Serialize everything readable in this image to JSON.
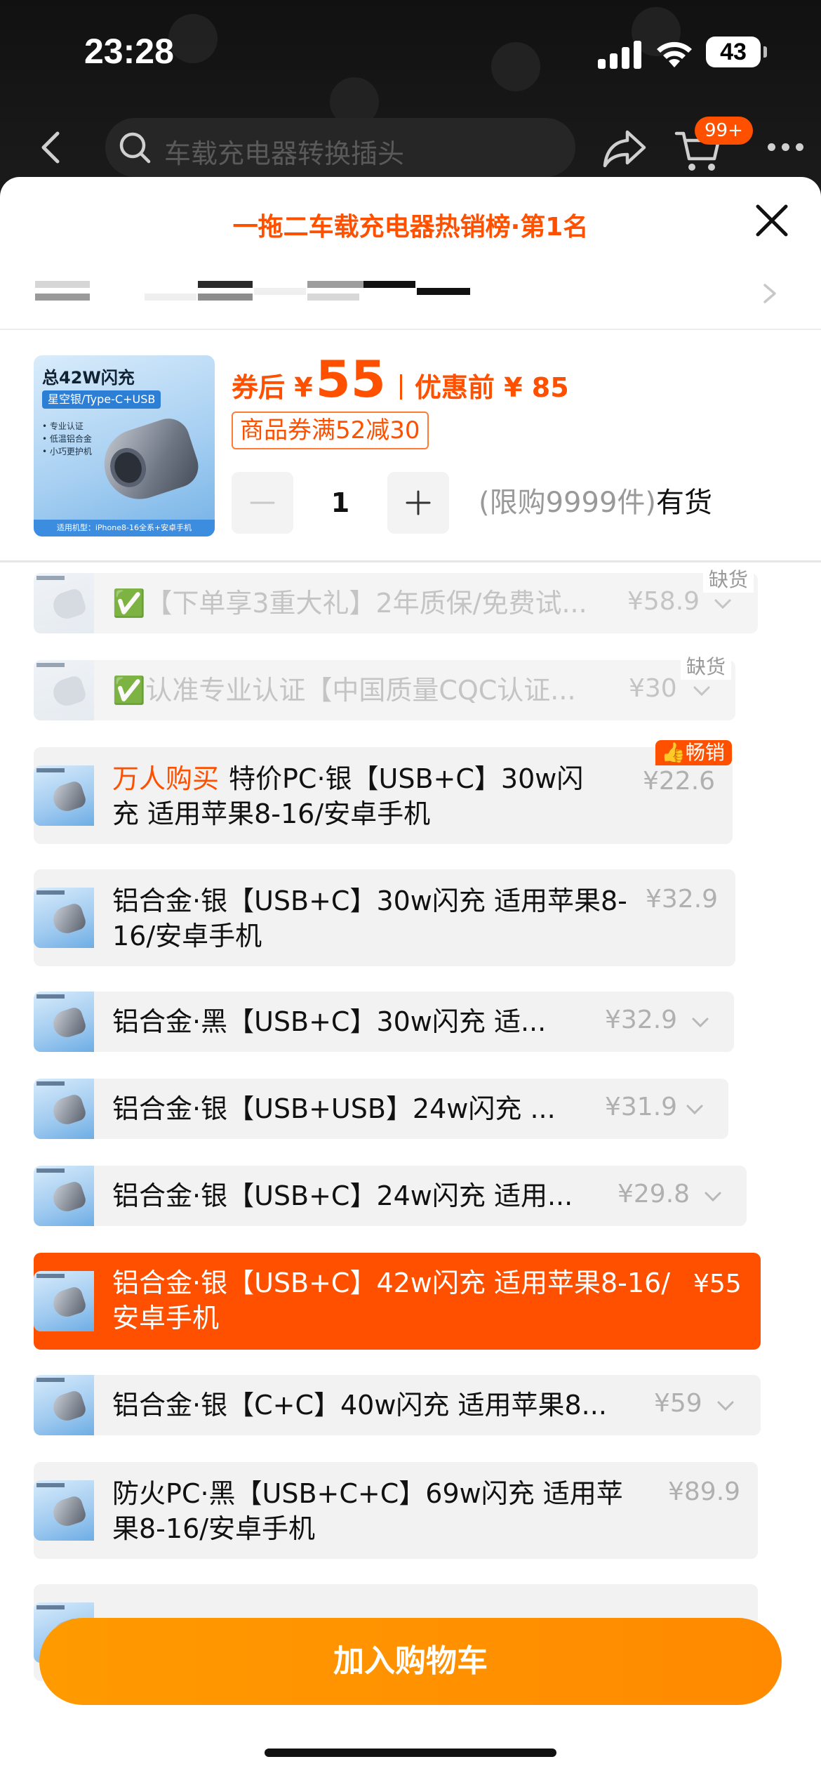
{
  "status_bar": {
    "time": "23:28",
    "battery": "43"
  },
  "nav": {
    "search_text": "车载充电器转换插头",
    "cart_badge": "99+"
  },
  "sheet": {
    "title": "一拖二车载充电器热销榜·第1名",
    "price": {
      "after_coupon_label": "券后 ¥",
      "after_coupon_value": "55",
      "original_label": "优惠前 ¥ 85",
      "coupon": "商品券满52减30"
    },
    "quantity": {
      "value": "1",
      "limit_text": "(限购9999件)",
      "stock_text": "有货"
    },
    "thumb": {
      "title": "总42W闪充",
      "tag": "星空银/Type-C+USB",
      "bullets": [
        "• 专业认证",
        "• 低温铝合金",
        "• 小巧更护机"
      ],
      "footer": "适用机型：iPhone8-16全系+安卓手机"
    }
  },
  "skus": [
    {
      "name": "✅【下单享3重大礼】2年质保/免费试...",
      "price": "¥58.9",
      "state": "disabled",
      "badge": "缺货"
    },
    {
      "name": "✅认准专业认证【中国质量CQC认证...",
      "price": "¥30",
      "state": "disabled",
      "badge": "缺货"
    },
    {
      "promo": "万人购买",
      "name": "特价PC·银【USB+C】30w闪充 适用苹果8-16/安卓手机",
      "price": "¥22.6",
      "state": "normal",
      "hot": "畅销"
    },
    {
      "name": "铝合金·银【USB+C】30w闪充 适用苹果8-16/安卓手机",
      "price": "¥32.9",
      "state": "normal"
    },
    {
      "name": "铝合金·黑【USB+C】30w闪充 适...",
      "price": "¥32.9",
      "state": "normal"
    },
    {
      "name": "铝合金·银【USB+USB】24w闪充 ...",
      "price": "¥31.9",
      "state": "normal"
    },
    {
      "name": "铝合金·银【USB+C】24w闪充 适用...",
      "price": "¥29.8",
      "state": "normal"
    },
    {
      "name": "铝合金·银【USB+C】42w闪充 适用苹果8-16/安卓手机",
      "price": "¥55",
      "state": "selected"
    },
    {
      "name": "铝合金·银【C+C】40w闪充 适用苹果8...",
      "price": "¥59",
      "state": "normal"
    },
    {
      "name": "防火PC·黑【USB+C+C】69w闪充 适用苹果8-16/安卓手机",
      "price": "¥89.9",
      "state": "normal"
    }
  ],
  "footer": {
    "add_to_cart": "加入购物车"
  },
  "colors": {
    "accent": "#ff5000",
    "button": "#ff8f00"
  }
}
